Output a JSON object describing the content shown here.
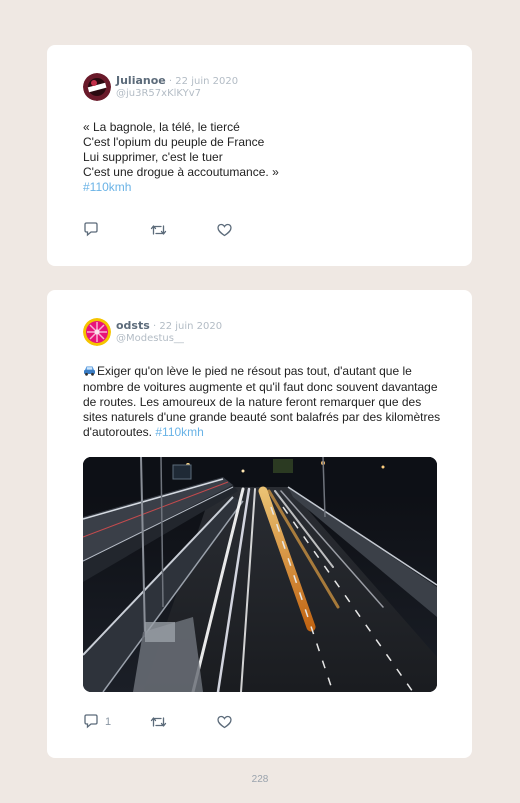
{
  "posts": [
    {
      "author": "Julianoe",
      "date_sep": " · ",
      "date": "22 juin 2020",
      "handle": "@ju3R57xKlKYv7",
      "text": "« La bagnole, la télé, le tiercé\nC'est l'opium du peuple de France\nLui supprimer, c'est le tuer\nC'est une drogue à accoutumance. »",
      "hashtag": "#110kmh",
      "reply_count": "",
      "avatar_colors": [
        "#6a1a2a",
        "#ffffff"
      ]
    },
    {
      "author": "odsts",
      "date_sep": " · ",
      "date": "22 juin 2020",
      "handle": "@Modestus__",
      "text": "Exiger qu'on lève le pied ne résout pas tout, d'autant que le nombre de voitures augmente et qu'il faut donc souvent davantage de routes. Les amoureux de la nature feront remarquer que des sites naturels d'une grande beauté sont balafrés par des kilomètres d'autoroutes.",
      "hashtag": "#110kmh",
      "reply_count": "1",
      "avatar_colors": [
        "#f5c400",
        "#e8127a"
      ]
    }
  ],
  "page_number": "228",
  "icons": [
    "reply-icon",
    "retweet-icon",
    "like-icon",
    "car-emoji-icon"
  ],
  "colors": {
    "background": "#efe8e3",
    "hashtag": "#6ab3e6",
    "icon": "#5c6b7a"
  }
}
